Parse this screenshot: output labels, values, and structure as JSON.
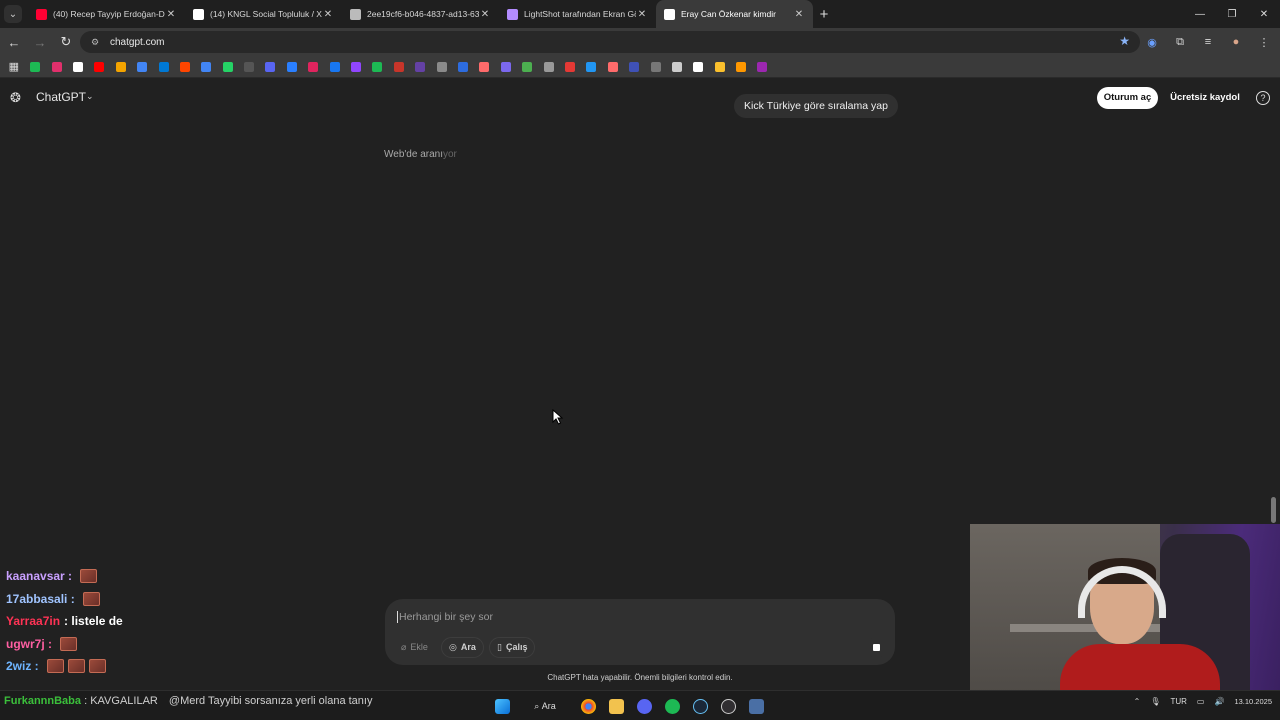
{
  "browser": {
    "tabs": [
      {
        "title": "(40) Recep Tayyip Erdoğan-Doli",
        "favicon": "youtube-icon",
        "color": "#ff0033",
        "active": false
      },
      {
        "title": "(14) KNGL Social Topluluk / X",
        "favicon": "x-icon",
        "color": "#ffffff",
        "active": false
      },
      {
        "title": "2ee19cf6-b046-4837-ad13-63",
        "favicon": "globe-icon",
        "color": "#bbbbbb",
        "active": false
      },
      {
        "title": "LightShot tarafından Ekran Gör",
        "favicon": "lightshot-icon",
        "color": "#b38cff",
        "active": false
      },
      {
        "title": "Eray Can Özkenar kimdir",
        "favicon": "chatgpt-icon",
        "color": "#ffffff",
        "active": true
      }
    ],
    "url": "chatgpt.com",
    "bookmark_colors": [
      "#1db954",
      "#e1306c",
      "#ffffff",
      "#ff0000",
      "#f4a400",
      "#4285f4",
      "#0078d4",
      "#ff4500",
      "#4285f4",
      "#25d366",
      "#555555",
      "#5865f2",
      "#2a7fff",
      "#e0245e",
      "#1877f2",
      "#9146ff",
      "#1db954",
      "#c7352a",
      "#6441a5",
      "#8a8a8a",
      "#2d6cdf",
      "#ff6b6b",
      "#7b68ee",
      "#4caf50",
      "#999999",
      "#e53935",
      "#2196f3",
      "#ff6b6b",
      "#3f51b5",
      "#777777",
      "#cccccc",
      "#ffffff",
      "#fbc02d",
      "#ff9800",
      "#9c27b0"
    ]
  },
  "chatgpt": {
    "model": "ChatGPT",
    "user_message": "Kick Türkiye göre sıralama yap",
    "login": "Oturum aç",
    "signup": "Ücretsiz kaydol",
    "status_main": "Web'de aranı",
    "status_fade": "yor",
    "composer_placeholder": "Herhangi bir şey sor",
    "attach": "Ekle",
    "search": "Ara",
    "study": "Çalış",
    "disclaimer": "ChatGPT hata yapabilir. Önemli bilgileri kontrol edin."
  },
  "stream_chat": [
    {
      "user": "kaanavsar :",
      "color": "#c9a0ff",
      "text": "",
      "emotes": 1
    },
    {
      "user": "17abbasali :",
      "color": "#a0c4ff",
      "text": "",
      "emotes": 1
    },
    {
      "user": "Yarraa7in",
      "color": "#ff3355",
      "text": ": listele de",
      "emotes": 0
    },
    {
      "user": "ugwr7j :",
      "color": "#ff5fa2",
      "text": "",
      "emotes": 1
    },
    {
      "user": "2wiz :",
      "color": "#6fb5ff",
      "text": "",
      "emotes": 3
    }
  ],
  "taskbar": {
    "ticker_user": "FurkannnBaba",
    "ticker_text": ": KAVGALILAR",
    "ticker2": "@Merd Tayyibi sorsanıza yerli olana tanıy",
    "search": "Ara",
    "lang": "TUR",
    "date": "13.10.2025"
  }
}
